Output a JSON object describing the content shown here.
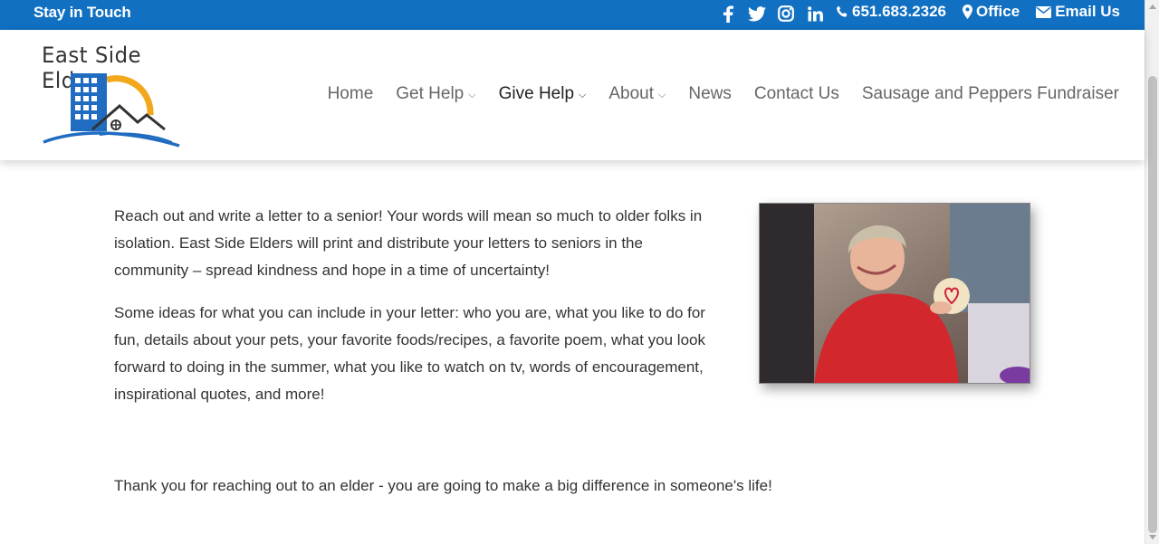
{
  "topbar": {
    "tagline": "Stay in Touch",
    "social": [
      {
        "name": "facebook-icon"
      },
      {
        "name": "twitter-icon"
      },
      {
        "name": "instagram-icon"
      },
      {
        "name": "linkedin-icon"
      }
    ],
    "phone": "651.683.2326",
    "office": "Office",
    "email": "Email Us",
    "bg_color": "#1170c2"
  },
  "logo": {
    "text": "East Side Elders"
  },
  "nav": {
    "items": [
      {
        "label": "Home",
        "has_dropdown": false
      },
      {
        "label": "Get Help",
        "has_dropdown": true
      },
      {
        "label": "Give Help",
        "has_dropdown": true,
        "active": true
      },
      {
        "label": "About",
        "has_dropdown": true
      },
      {
        "label": "News",
        "has_dropdown": false
      },
      {
        "label": "Contact Us",
        "has_dropdown": false
      },
      {
        "label": "Sausage and Peppers Fundraiser",
        "has_dropdown": false
      }
    ]
  },
  "content": {
    "paragraph1": "Reach out and write a letter to a senior!  Your words will mean so much to older folks in isolation.  East Side Elders will print and distribute your letters to seniors in the community – spread kindness and hope in a time of uncertainty!",
    "paragraph2": "Some ideas for what you can include in your letter:  who you are, what you like to do for fun, details about your pets, your favorite foods/recipes, a favorite poem, what you look forward to doing in the summer, what you like to watch on tv, words of encouragement, inspirational quotes, and more!",
    "thanks": "Thank you for reaching out to an elder - you are going to make a big difference in someone's life!"
  }
}
